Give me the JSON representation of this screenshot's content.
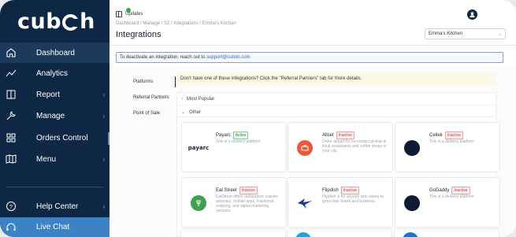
{
  "sidebar": {
    "logo": "cuboh",
    "items": [
      {
        "label": "Dashboard",
        "icon": "home-icon",
        "chevron": false
      },
      {
        "label": "Analytics",
        "icon": "analytics-icon",
        "chevron": false
      },
      {
        "label": "Report",
        "icon": "report-icon",
        "chevron": true
      },
      {
        "label": "Manage",
        "icon": "wrench-icon",
        "chevron": true
      },
      {
        "label": "Orders Control",
        "icon": "grid-icon",
        "chevron": false
      },
      {
        "label": "Menu",
        "icon": "map-icon",
        "chevron": true
      }
    ],
    "help_center": "Help Center",
    "live_chat": "Live Chat"
  },
  "header": {
    "updates": "Updates",
    "breadcrumb": "Dashboard / Manage / S2 / Integrations / Emma's Kitchen",
    "title": "Integrations",
    "store_select": "Emma's Kitchen"
  },
  "notice": {
    "text": "To deactivate an integration, reach out to ",
    "email": "support@cuboh.com"
  },
  "tabs": [
    "Platforms",
    "Referral Partners",
    "Point of Sale"
  ],
  "info_bar": "Don't have one of these integrations? Click the \"Referral Partners\" tab for more details.",
  "accordions": {
    "most_popular": "Most Popular",
    "other": "Other"
  },
  "badges": {
    "active": "Active",
    "inactive": "Inactive"
  },
  "integrations": [
    {
      "name": "Payarc",
      "status": "active",
      "desc": "This is a delivery platform",
      "logo_text": "payarc",
      "color": "#1a2233"
    },
    {
      "name": "Allset",
      "status": "inactive",
      "desc": "Order ahead for no-contact pickup at local restaurants and coffee shops in your city.",
      "logo_text": "",
      "color": "#e8583a"
    },
    {
      "name": "Cellek",
      "status": "inactive",
      "desc": "This is a delivery platform",
      "logo_text": "",
      "color": "#0d1b33"
    },
    {
      "name": "Eat Street",
      "status": "inactive",
      "desc": "EatStreet offers restaurants custom websites, mobile apps, Facebook ordering, and digital marketing services.",
      "logo_text": "",
      "color": "#3fa34d"
    },
    {
      "name": "Flipdish",
      "status": "inactive",
      "desc": "Flipdish is for anyone who wants to grow their brand and business.",
      "logo_text": "",
      "color": "#1e3a8a"
    },
    {
      "name": "GoDaddy",
      "status": "inactive",
      "desc": "This is a delivery platform",
      "logo_text": "",
      "color": "#0d1b33"
    }
  ]
}
